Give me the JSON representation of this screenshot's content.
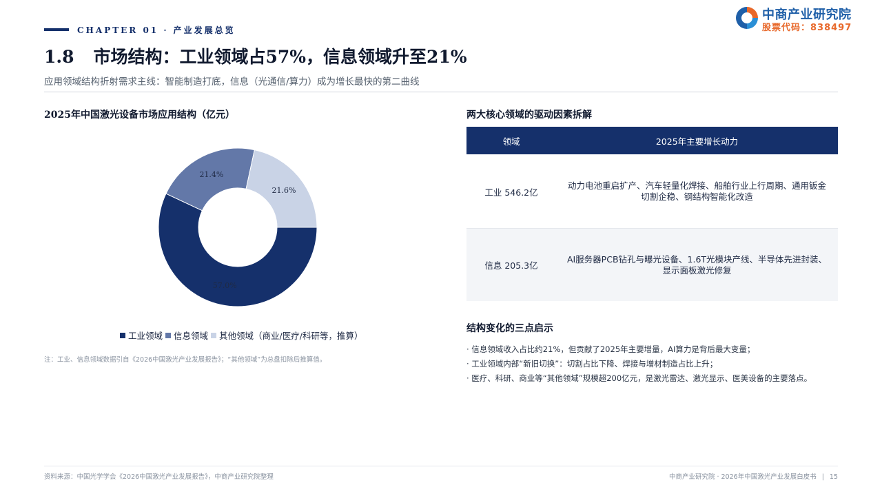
{
  "header": {
    "chapter": "CHAPTER 01 · 产业发展总览",
    "logo_name": "中商产业研究院",
    "logo_code": "股票代码：838497",
    "title_num": "1.8",
    "title": "市场结构：工业领域占57%，信息领域升至21%",
    "subtitle": "应用领域结构折射需求主线：智能制造打底，信息（光通信/算力）成为增长最快的第二曲线"
  },
  "chart_title": "2025年中国激光设备市场应用结构（亿元）",
  "chart_data": {
    "type": "pie",
    "variant": "donut",
    "labels": [
      "工业领域",
      "信息领域",
      "其他领域（商业/医疗/科研等，推算）"
    ],
    "values": [
      57.0,
      21.4,
      21.6
    ],
    "value_labels": [
      "57.0%",
      "21.4%",
      "21.6%"
    ],
    "colors": [
      "#15306b",
      "#6378a8",
      "#c9d3e6"
    ],
    "legend_position": "bottom"
  },
  "chart_note": "注：工业、信息领域数据引自《2026中国激光产业发展报告》；“其他领域”为总盘扣除后推算值。",
  "drivers": {
    "title": "两大核心领域的驱动因素拆解",
    "headers": [
      "领域",
      "2025年主要增长动力"
    ],
    "rows": [
      {
        "field": "工业 546.2亿",
        "driver": "动力电池重启扩产、汽车轻量化焊接、船舶行业上行周期、通用钣金切割企稳、钢结构智能化改造"
      },
      {
        "field": "信息 205.3亿",
        "driver": "AI服务器PCB钻孔与曝光设备、1.6T光模块产线、半导体先进封装、显示面板激光修复"
      }
    ]
  },
  "insights": {
    "title": "结构变化的三点启示",
    "items": [
      "· 信息领域收入占比约21%，但贡献了2025年主要增量，AI算力是背后最大变量；",
      "· 工业领域内部“新旧切换”：切割占比下降、焊接与增材制造占比上升；",
      "· 医疗、科研、商业等“其他领域”规模超200亿元，是激光雷达、激光显示、医美设备的主要落点。"
    ]
  },
  "footer": {
    "source": "资料来源：中国光学学会《2026中国激光产业发展报告》，中商产业研究院整理",
    "report": "中商产业研究院 · 2026年中国激光产业发展白皮书",
    "page": "15"
  }
}
